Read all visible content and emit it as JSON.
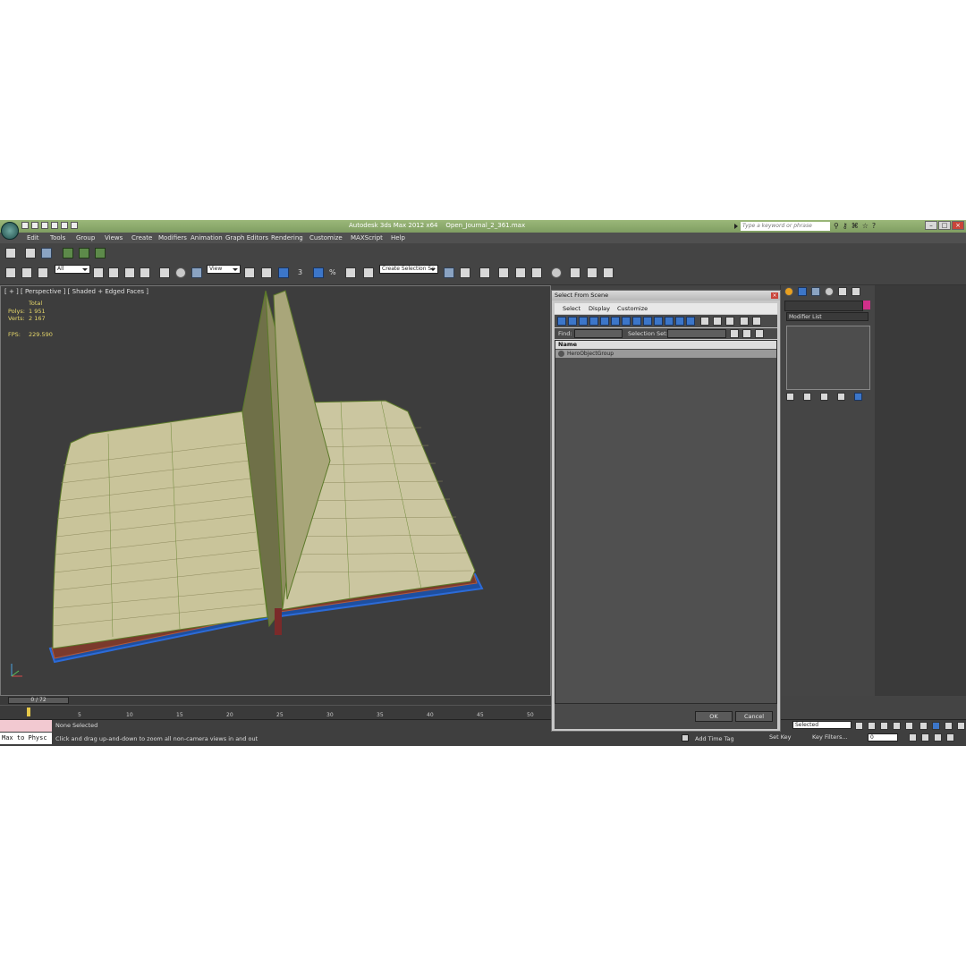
{
  "app": {
    "title": "Autodesk 3ds Max  2012 x64",
    "file_name": "Open_Journal_2_361.max",
    "search_placeholder": "Type a keyword or phrase"
  },
  "menu": [
    "Edit",
    "Tools",
    "Group",
    "Views",
    "Create",
    "Modifiers",
    "Animation",
    "Graph Editors",
    "Rendering",
    "Customize",
    "MAXScript",
    "Help"
  ],
  "toolbar": {
    "selection_filter": "All",
    "ref_coord": "View",
    "named_selection": "Create Selection Se",
    "snap_label": "3",
    "percent_snap": "%"
  },
  "viewport": {
    "label": "[ + ] [ Perspective ] [ Shaded + Edged Faces ]",
    "stats_header": "Total",
    "polys_label": "Polys:",
    "polys_value": "1 951",
    "verts_label": "Verts:",
    "verts_value": "2 167",
    "fps_label": "FPS:",
    "fps_value": "229.590",
    "accent_color": "#e6d76a"
  },
  "timeline": {
    "slider": "0 / 72",
    "ticks": [
      "5",
      "10",
      "15",
      "20",
      "25",
      "30",
      "35",
      "40",
      "45",
      "50"
    ]
  },
  "status": {
    "selection": "None Selected",
    "prompt": "Click and drag up-and-down to zoom all non-camera views in and out",
    "maxscript_listener": "Max to Physc",
    "add_time_tag": "Add Time Tag",
    "set_key": "Set Key",
    "key_filters": "Key Filters...",
    "key_mode": "Selected",
    "frame_value": "0"
  },
  "command_panel": {
    "modifier_list": "Modifier List"
  },
  "dialog": {
    "title": "Select From Scene",
    "menu": [
      "Select",
      "Display",
      "Customize"
    ],
    "find_label": "Find:",
    "selection_set_label": "Selection Set:",
    "column_name": "Name",
    "items": [
      "HeroObjectGroup"
    ],
    "ok": "OK",
    "cancel": "Cancel"
  }
}
